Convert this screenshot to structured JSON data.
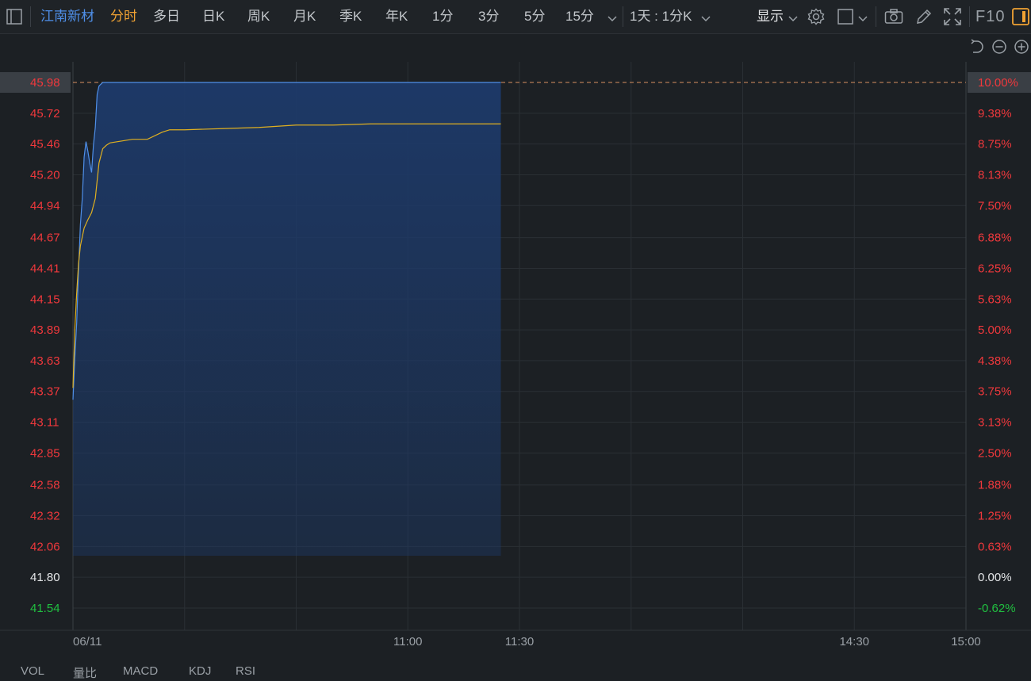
{
  "toolbar": {
    "stock_name": "江南新材",
    "periods": [
      "分时",
      "多日",
      "日K",
      "周K",
      "月K",
      "季K",
      "年K",
      "1分",
      "3分",
      "5分",
      "15分"
    ],
    "active_period": "分时",
    "range_select": "1天 : 1分K",
    "display_label": "显示",
    "f10_label": "F10"
  },
  "colors": {
    "background": "#1c2024",
    "price_line": "#4f8fe8",
    "avg_line": "#e0b020",
    "up": "#f0383c",
    "down": "#20c040",
    "neutral": "#e4e6e8",
    "accent": "#f0a233"
  },
  "chart_data": {
    "type": "line",
    "y_left_ticks": [
      "45.98",
      "45.72",
      "45.46",
      "45.20",
      "44.94",
      "44.67",
      "44.41",
      "44.15",
      "43.89",
      "43.63",
      "43.37",
      "43.11",
      "42.85",
      "42.58",
      "42.32",
      "42.06",
      "41.80",
      "41.54"
    ],
    "y_right_ticks": [
      "10.00%",
      "9.38%",
      "8.75%",
      "8.13%",
      "7.50%",
      "6.88%",
      "6.25%",
      "5.63%",
      "5.00%",
      "4.38%",
      "3.75%",
      "3.13%",
      "2.50%",
      "1.88%",
      "1.25%",
      "0.63%",
      "0.00%",
      "-0.62%"
    ],
    "ylim": [
      41.54,
      45.98
    ],
    "prev_close": 41.8,
    "limit_up": 45.98,
    "x_labels": [
      {
        "label": "06/11",
        "time": "09:30"
      },
      {
        "label": "11:00",
        "time": "11:00"
      },
      {
        "label": "11:30",
        "time": "11:30"
      },
      {
        "label": "14:30",
        "time": "14:30"
      },
      {
        "label": "15:00",
        "time": "15:00"
      }
    ],
    "session_minutes": 240,
    "series": [
      {
        "x_min": [
          0,
          0.5,
          1,
          1.5,
          2,
          2.5,
          3,
          3.5,
          4,
          4.5,
          5,
          5.5,
          6,
          6.5,
          7,
          8,
          9,
          10,
          12,
          16,
          20,
          30,
          40,
          60,
          80,
          100,
          115
        ],
        "values": [
          43.3,
          43.65,
          43.95,
          44.4,
          44.78,
          45.0,
          45.35,
          45.48,
          45.4,
          45.3,
          45.22,
          45.45,
          45.6,
          45.88,
          45.95,
          45.98,
          45.98,
          45.98,
          45.98,
          45.98,
          45.98,
          45.98,
          45.98,
          45.98,
          45.98,
          45.98,
          45.98
        ]
      },
      {
        "x_min": [
          0,
          0.5,
          1,
          1.5,
          2,
          3,
          4,
          5,
          6,
          7,
          8,
          9,
          10,
          12,
          14,
          16,
          20,
          24,
          26,
          30,
          40,
          50,
          55,
          60,
          70,
          80,
          100,
          115
        ],
        "values": [
          43.4,
          43.9,
          44.2,
          44.45,
          44.6,
          44.75,
          44.82,
          44.88,
          45.0,
          45.3,
          45.42,
          45.45,
          45.47,
          45.48,
          45.49,
          45.5,
          45.5,
          45.56,
          45.58,
          45.58,
          45.59,
          45.6,
          45.61,
          45.62,
          45.62,
          45.63,
          45.63,
          45.63
        ]
      }
    ],
    "grid": true
  },
  "bottom_tabs": [
    "VOL",
    "量比",
    "MACD",
    "KDJ",
    "RSI"
  ]
}
